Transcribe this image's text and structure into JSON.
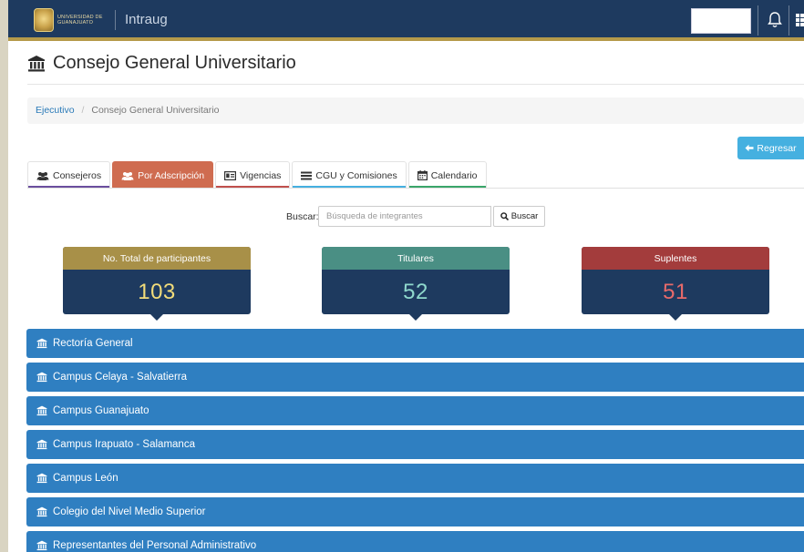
{
  "topbar": {
    "logo_text": [
      "UNIVERSIDAD DE",
      "GUANAJUATO"
    ],
    "app_name": "Intraug",
    "search_value": ""
  },
  "page": {
    "title": "Consejo General Universitario"
  },
  "breadcrumb": {
    "items": [
      "Ejecutivo",
      "Consejo General Universitario"
    ]
  },
  "regresar_label": "Regresar",
  "tabs": [
    {
      "label": "Consejeros",
      "icon": "users-icon",
      "color": "#6b4e9e"
    },
    {
      "label": "Por Adscripción",
      "icon": "users-icon",
      "color": "#cf6c50",
      "active": true
    },
    {
      "label": "Vigencias",
      "icon": "id-card-icon",
      "color": "#c0504d"
    },
    {
      "label": "CGU y Comisiones",
      "icon": "list-icon",
      "color": "#45b0e0"
    },
    {
      "label": "Calendario",
      "icon": "calendar-icon",
      "color": "#3aa66a"
    }
  ],
  "search": {
    "label": "Buscar:",
    "placeholder": "Búsqueda de integrantes",
    "button_label": "Buscar"
  },
  "stats": [
    {
      "label": "No. Total de participantes",
      "value": "103",
      "header_color": "#a89048",
      "value_color": "#f2dc7a"
    },
    {
      "label": "Titulares",
      "value": "52",
      "header_color": "#4a8f84",
      "value_color": "#8fd8cc"
    },
    {
      "label": "Suplentes",
      "value": "51",
      "header_color": "#a33c3c",
      "value_color": "#e86a6a"
    }
  ],
  "sections": [
    "Rectoría General",
    "Campus Celaya - Salvatierra",
    "Campus Guanajuato",
    "Campus Irapuato - Salamanca",
    "Campus León",
    "Colegio del Nivel Medio Superior",
    "Representantes del Personal Administrativo"
  ]
}
